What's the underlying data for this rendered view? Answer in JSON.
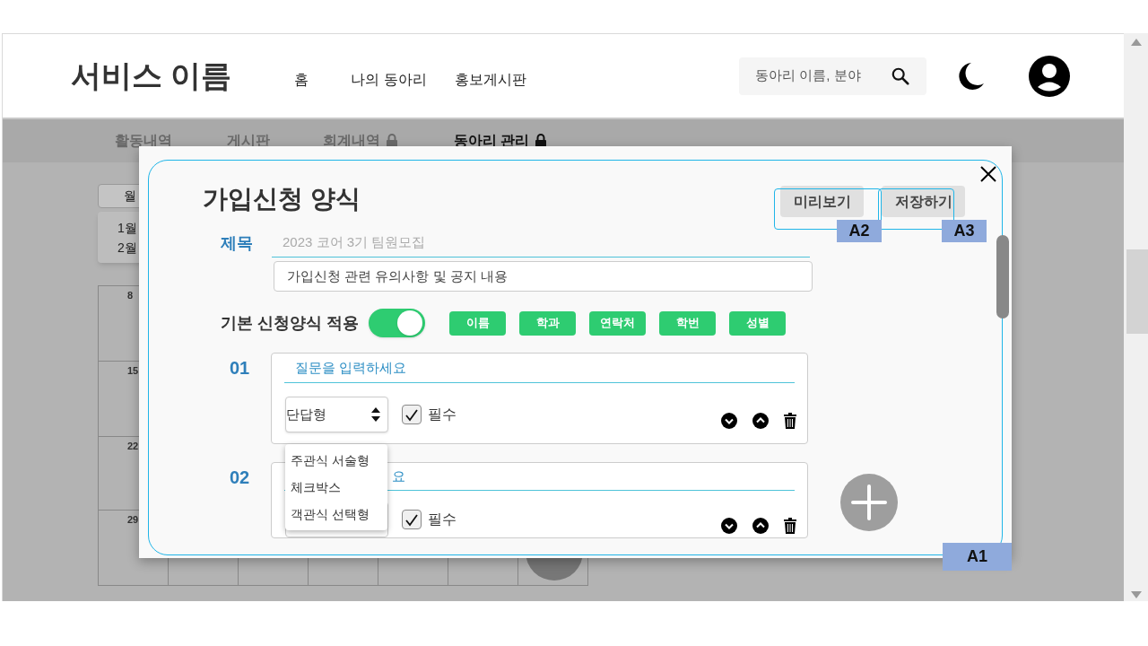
{
  "header": {
    "logo": "서비스 이름",
    "nav": [
      {
        "label": "홈"
      },
      {
        "label": "나의 동아리"
      },
      {
        "label": "홍보게시판"
      }
    ],
    "search": {
      "placeholder": "동아리 이름, 분야"
    }
  },
  "tabs": [
    {
      "label": "활동내역",
      "selected": false,
      "locked": false
    },
    {
      "label": "게시판",
      "selected": false,
      "locked": false
    },
    {
      "label": "회계내역",
      "selected": false,
      "locked": true
    },
    {
      "label": "동아리 관리",
      "selected": true,
      "locked": true
    }
  ],
  "calendar": {
    "view": "월",
    "months": [
      "1월",
      "2월"
    ],
    "days": [
      "8",
      "15",
      "22",
      "29"
    ]
  },
  "modal": {
    "title": "가입신청 양식",
    "buttons": [
      "미리보기",
      "저장하기"
    ],
    "subject_label": "제목",
    "subject_placeholder": "2023 코어 3기 팀원모집",
    "notice_placeholder": "가입신청 관련 유의사항 및 공지 내용",
    "default_form": {
      "label": "기본 신청양식 적용",
      "on": true,
      "fields": [
        "이름",
        "학과",
        "연락처",
        "학번",
        "성별"
      ]
    },
    "questions": [
      {
        "number": "01",
        "placeholder": "질문을 입력하세요",
        "type": "단답형",
        "required": true,
        "required_label": "필수",
        "dropdown_open": true
      },
      {
        "number": "02",
        "placeholder": "요",
        "required": true,
        "required_label": "필수",
        "dropdown_open": false
      }
    ],
    "type_options": [
      "주관식 서술형",
      "체크박스",
      "객관식 선택형"
    ]
  },
  "annotations": [
    {
      "label": "A1"
    },
    {
      "label": "A2"
    },
    {
      "label": "A3"
    }
  ]
}
